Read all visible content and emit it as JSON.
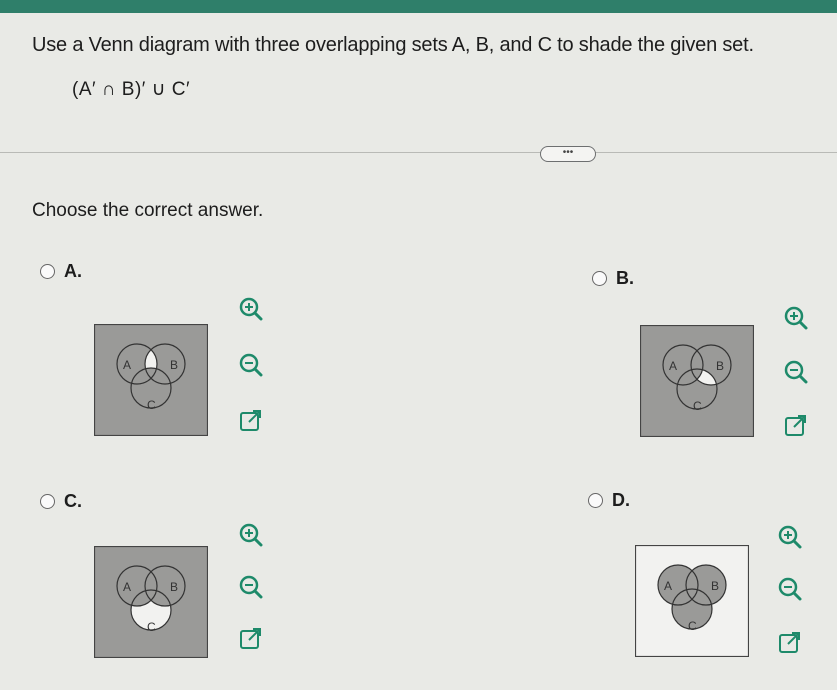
{
  "question": "Use a Venn diagram with three overlapping sets A, B, and C to shade the given set.",
  "expression": "(A′ ∩ B)′ ∪ C′",
  "more_label": "•••",
  "prompt": "Choose the correct answer.",
  "options": [
    {
      "label": "A.",
      "set_labels": {
        "a": "A",
        "b": "B",
        "c": "C"
      }
    },
    {
      "label": "B.",
      "set_labels": {
        "a": "A",
        "b": "B",
        "c": "C"
      }
    },
    {
      "label": "C.",
      "set_labels": {
        "a": "A",
        "b": "B",
        "c": "C"
      }
    },
    {
      "label": "D.",
      "set_labels": {
        "a": "A",
        "b": "B",
        "c": "C"
      }
    }
  ],
  "tool_icons": [
    "zoom-in-icon",
    "zoom-out-icon",
    "open-external-icon"
  ],
  "colors": {
    "shade": "#9a9a98",
    "accent": "#2f7f6a",
    "tool_icon": "#1e8a6a"
  }
}
